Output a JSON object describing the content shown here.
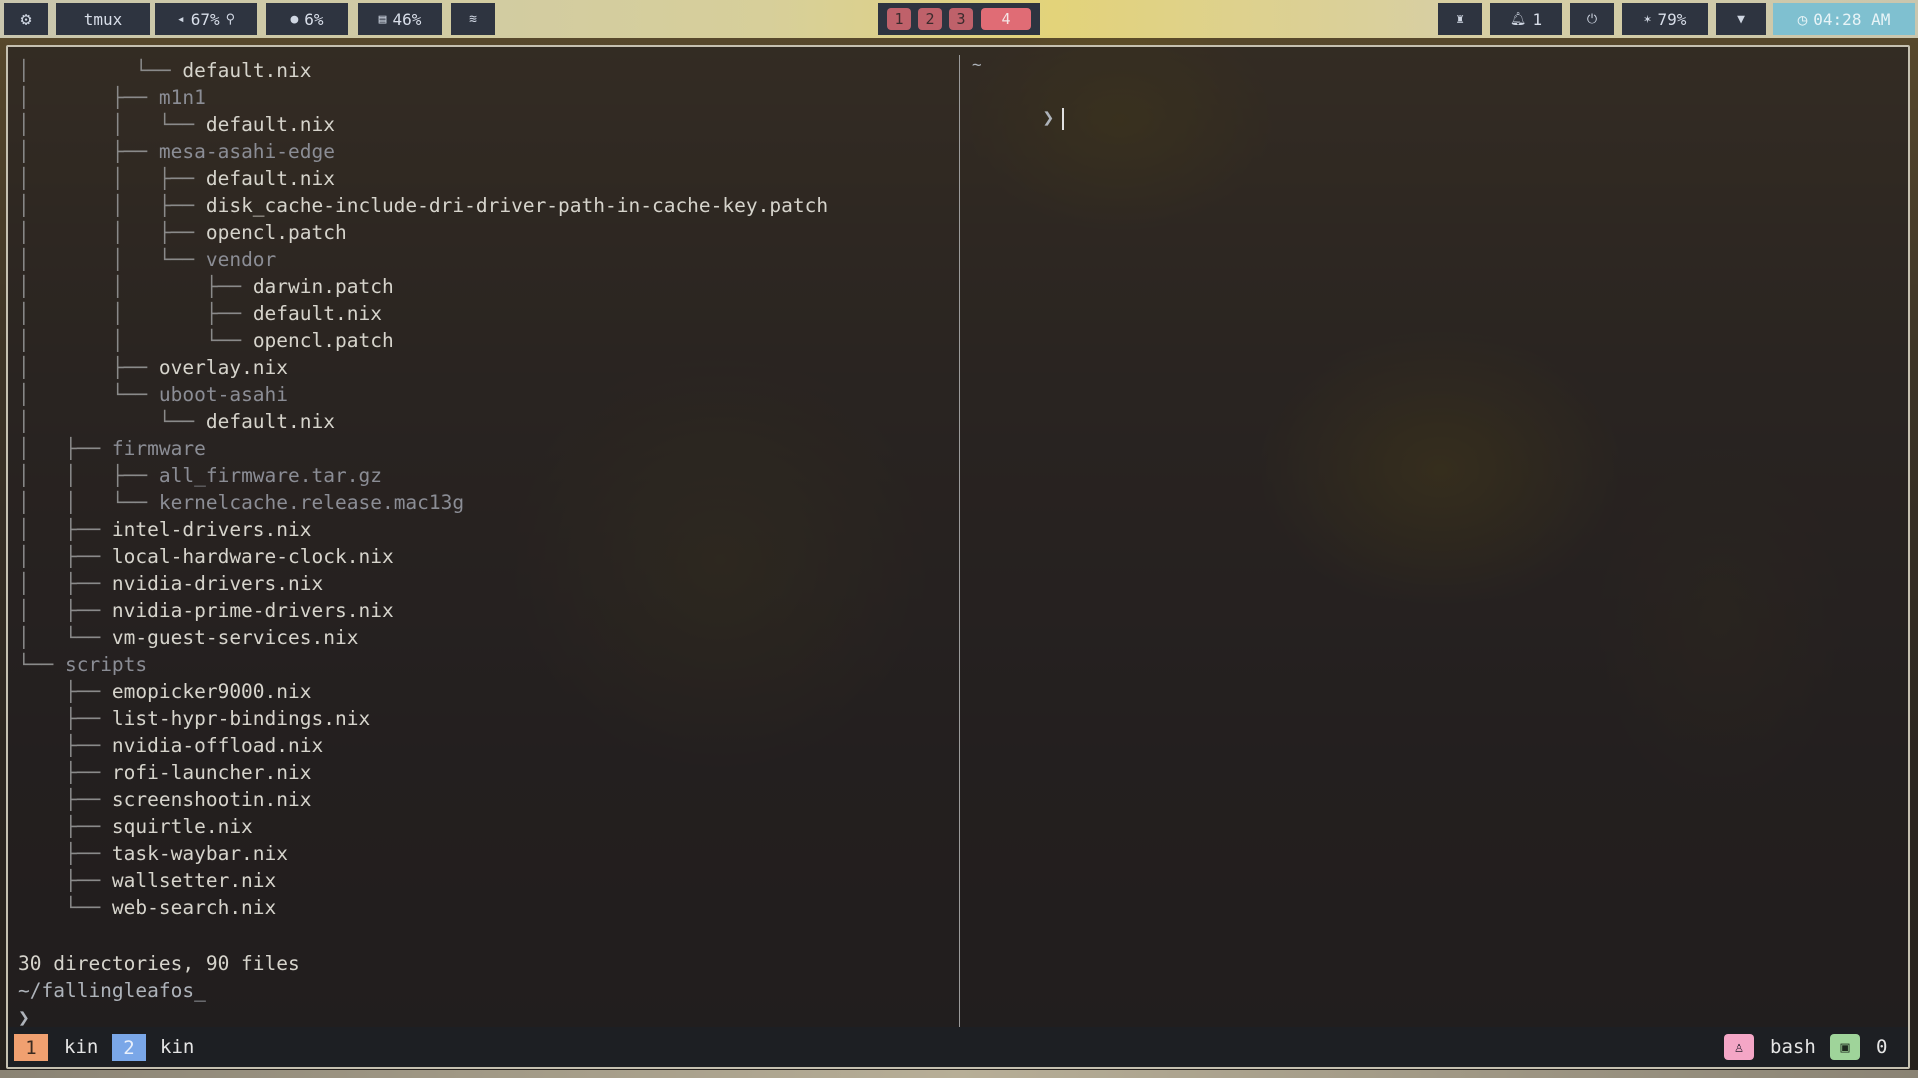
{
  "topbar": {
    "launcher_icon": "gear-icon",
    "app_label": "tmux",
    "volume": {
      "icon": "speaker-icon",
      "value": "67%",
      "mic_icon": "mic-icon"
    },
    "cpu": {
      "icon": "cpu-icon",
      "value": "6%"
    },
    "memory": {
      "icon": "memory-icon",
      "value": "46%"
    },
    "network_icon": "wifi-off-icon",
    "workspaces": [
      "1",
      "2",
      "3",
      "4"
    ],
    "active_workspace": "4",
    "idle_icon": "coffee-icon",
    "notifications": {
      "icon": "bell-icon",
      "count": "1"
    },
    "power_icon": "power-icon",
    "brightness": {
      "icon": "brightness-icon",
      "value": "79%"
    },
    "wifi_icon": "wifi-icon",
    "clock": {
      "icon": "clock-icon",
      "time": "04:28 AM"
    }
  },
  "left_pane": {
    "lines": [
      {
        "tree": "│         └── ",
        "name": "default.nix",
        "kind": "file"
      },
      {
        "tree": "│       ├── ",
        "name": "m1n1",
        "kind": "dir"
      },
      {
        "tree": "│       │   └── ",
        "name": "default.nix",
        "kind": "file"
      },
      {
        "tree": "│       ├── ",
        "name": "mesa-asahi-edge",
        "kind": "dir"
      },
      {
        "tree": "│       │   ├── ",
        "name": "default.nix",
        "kind": "file"
      },
      {
        "tree": "│       │   ├── ",
        "name": "disk_cache-include-dri-driver-path-in-cache-key.patch",
        "kind": "file"
      },
      {
        "tree": "│       │   ├── ",
        "name": "opencl.patch",
        "kind": "file"
      },
      {
        "tree": "│       │   └── ",
        "name": "vendor",
        "kind": "dir"
      },
      {
        "tree": "│       │       ├── ",
        "name": "darwin.patch",
        "kind": "file"
      },
      {
        "tree": "│       │       ├── ",
        "name": "default.nix",
        "kind": "file"
      },
      {
        "tree": "│       │       └── ",
        "name": "opencl.patch",
        "kind": "file"
      },
      {
        "tree": "│       ├── ",
        "name": "overlay.nix",
        "kind": "file"
      },
      {
        "tree": "│       └── ",
        "name": "uboot-asahi",
        "kind": "dir"
      },
      {
        "tree": "│           └── ",
        "name": "default.nix",
        "kind": "file"
      },
      {
        "tree": "│   ├── ",
        "name": "firmware",
        "kind": "dir"
      },
      {
        "tree": "│   │   ├── ",
        "name": "all_firmware.tar.gz",
        "kind": "dir"
      },
      {
        "tree": "│   │   └── ",
        "name": "kernelcache.release.mac13g",
        "kind": "dir"
      },
      {
        "tree": "│   ├── ",
        "name": "intel-drivers.nix",
        "kind": "file"
      },
      {
        "tree": "│   ├── ",
        "name": "local-hardware-clock.nix",
        "kind": "file"
      },
      {
        "tree": "│   ├── ",
        "name": "nvidia-drivers.nix",
        "kind": "file"
      },
      {
        "tree": "│   ├── ",
        "name": "nvidia-prime-drivers.nix",
        "kind": "file"
      },
      {
        "tree": "│   └── ",
        "name": "vm-guest-services.nix",
        "kind": "file"
      },
      {
        "tree": "└── ",
        "name": "scripts",
        "kind": "dir"
      },
      {
        "tree": "    ├── ",
        "name": "emopicker9000.nix",
        "kind": "file"
      },
      {
        "tree": "    ├── ",
        "name": "list-hypr-bindings.nix",
        "kind": "file"
      },
      {
        "tree": "    ├── ",
        "name": "nvidia-offload.nix",
        "kind": "file"
      },
      {
        "tree": "    ├── ",
        "name": "rofi-launcher.nix",
        "kind": "file"
      },
      {
        "tree": "    ├── ",
        "name": "screenshootin.nix",
        "kind": "file"
      },
      {
        "tree": "    ├── ",
        "name": "squirtle.nix",
        "kind": "file"
      },
      {
        "tree": "    ├── ",
        "name": "task-waybar.nix",
        "kind": "file"
      },
      {
        "tree": "    ├── ",
        "name": "wallsetter.nix",
        "kind": "file"
      },
      {
        "tree": "    └── ",
        "name": "web-search.nix",
        "kind": "file"
      }
    ],
    "summary": "30 directories, 90 files",
    "cwd": "~/fallingleafos_",
    "prompt": "❯"
  },
  "right_pane": {
    "cwd": "~",
    "prompt": "❯"
  },
  "tmux_status": {
    "windows": [
      {
        "index": "1",
        "name": "kin"
      },
      {
        "index": "2",
        "name": "kin"
      }
    ],
    "session_icon": "person-icon",
    "shell": "bash",
    "terminal_icon": "terminal-icon",
    "pane_count": "0"
  },
  "colors": {
    "bar_bg": "#2e3440",
    "workspace": "#bf616a",
    "clock": "#7fc0d0",
    "win1": "#f0a070",
    "win2": "#7aa7e8",
    "session_badge": "#f4a6c6",
    "terminal_badge": "#9fd49a"
  }
}
